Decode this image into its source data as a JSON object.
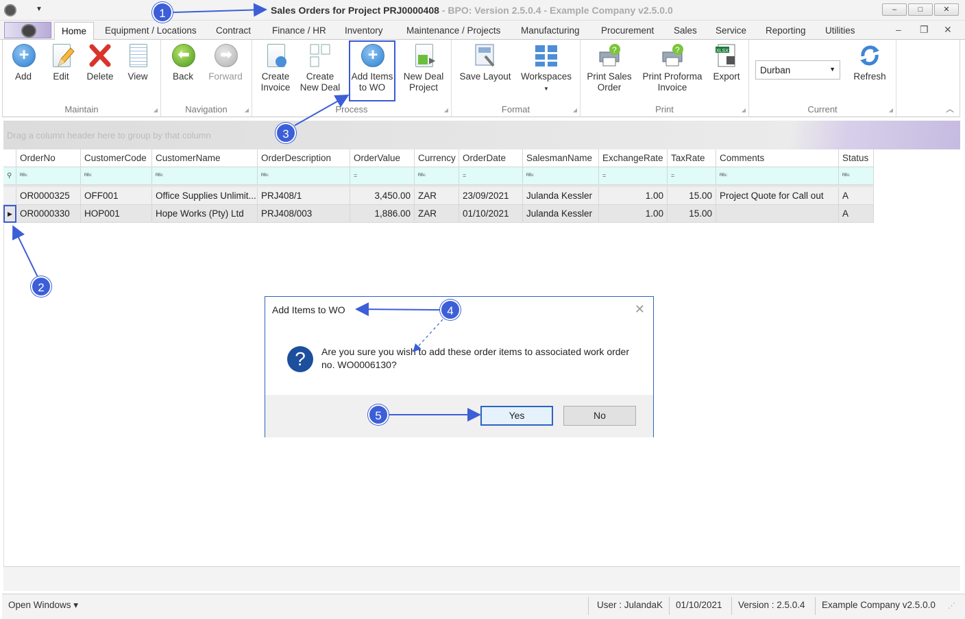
{
  "window": {
    "title": "Sales Orders for Project PRJ0000408",
    "subtitle": "- BPO: Version 2.5.0.4 - Example Company v2.5.0.0",
    "minimize": "–",
    "maximize": "□",
    "close": "✕"
  },
  "tabs": [
    "Home",
    "Equipment / Locations",
    "Contract",
    "Finance / HR",
    "Inventory",
    "Maintenance / Projects",
    "Manufacturing",
    "Procurement",
    "Sales",
    "Service",
    "Reporting",
    "Utilities"
  ],
  "mdi": {
    "minimize": "–",
    "restore": "❐",
    "close": "✕"
  },
  "ribbon": {
    "maintain": {
      "label": "Maintain",
      "add": "Add",
      "edit": "Edit",
      "delete": "Delete",
      "view": "View"
    },
    "navigation": {
      "label": "Navigation",
      "back": "Back",
      "forward": "Forward"
    },
    "process": {
      "label": "Process",
      "create_invoice": [
        "Create",
        "Invoice"
      ],
      "create_new_deal": [
        "Create",
        "New Deal"
      ],
      "add_items_to_wo": [
        "Add Items",
        "to WO"
      ],
      "new_deal_project": [
        "New Deal",
        "Project"
      ]
    },
    "format": {
      "label": "Format",
      "save_layout": "Save Layout",
      "workspaces": "Workspaces"
    },
    "print": {
      "label": "Print",
      "print_sales_order": [
        "Print Sales",
        "Order"
      ],
      "print_proforma_invoice": [
        "Print Proforma",
        "Invoice"
      ],
      "export": "Export"
    },
    "current": {
      "label": "Current",
      "location": "Durban",
      "refresh": "Refresh"
    }
  },
  "grid": {
    "group_hint": "Drag a column header here to group by that column",
    "columns": [
      "OrderNo",
      "CustomerCode",
      "CustomerName",
      "OrderDescription",
      "OrderValue",
      "Currency",
      "OrderDate",
      "SalesmanName",
      "ExchangeRate",
      "TaxRate",
      "Comments",
      "Status"
    ],
    "filters": [
      "ᴿᴮᶜ",
      "ᴿᴮᶜ",
      "ᴿᴮᶜ",
      "ᴿᴮᶜ",
      "=",
      "ᴿᴮᶜ",
      "=",
      "ᴿᴮᶜ",
      "=",
      "=",
      "ᴿᴮᶜ",
      "ᴿᴮᶜ"
    ],
    "rows": [
      [
        "OR0000325",
        "OFF001",
        "Office Supplies Unlimit...",
        "PRJ408/1",
        "3,450.00",
        "ZAR",
        "23/09/2021",
        "Julanda Kessler",
        "1.00",
        "15.00",
        "Project Quote for Call out",
        "A"
      ],
      [
        "OR0000330",
        "HOP001",
        "Hope Works (Pty) Ltd",
        "PRJ408/003",
        "1,886.00",
        "ZAR",
        "01/10/2021",
        "Julanda Kessler",
        "1.00",
        "15.00",
        "",
        "A"
      ]
    ]
  },
  "dialog": {
    "title": "Add Items to WO",
    "message": "Are you sure you wish to add these order items to associated work order no. WO0006130?",
    "yes": "Yes",
    "no": "No"
  },
  "statusbar": {
    "open_windows": "Open Windows ▾",
    "user": "User : JulandaK",
    "date": "01/10/2021",
    "version": "Version : 2.5.0.4",
    "company": "Example Company v2.5.0.0"
  },
  "annotations": [
    "1",
    "2",
    "3",
    "4",
    "5"
  ],
  "colors": {
    "annotation": "#3c5ed7",
    "highlight": "#3a59d0",
    "filter_row": "#e0fbf8"
  }
}
